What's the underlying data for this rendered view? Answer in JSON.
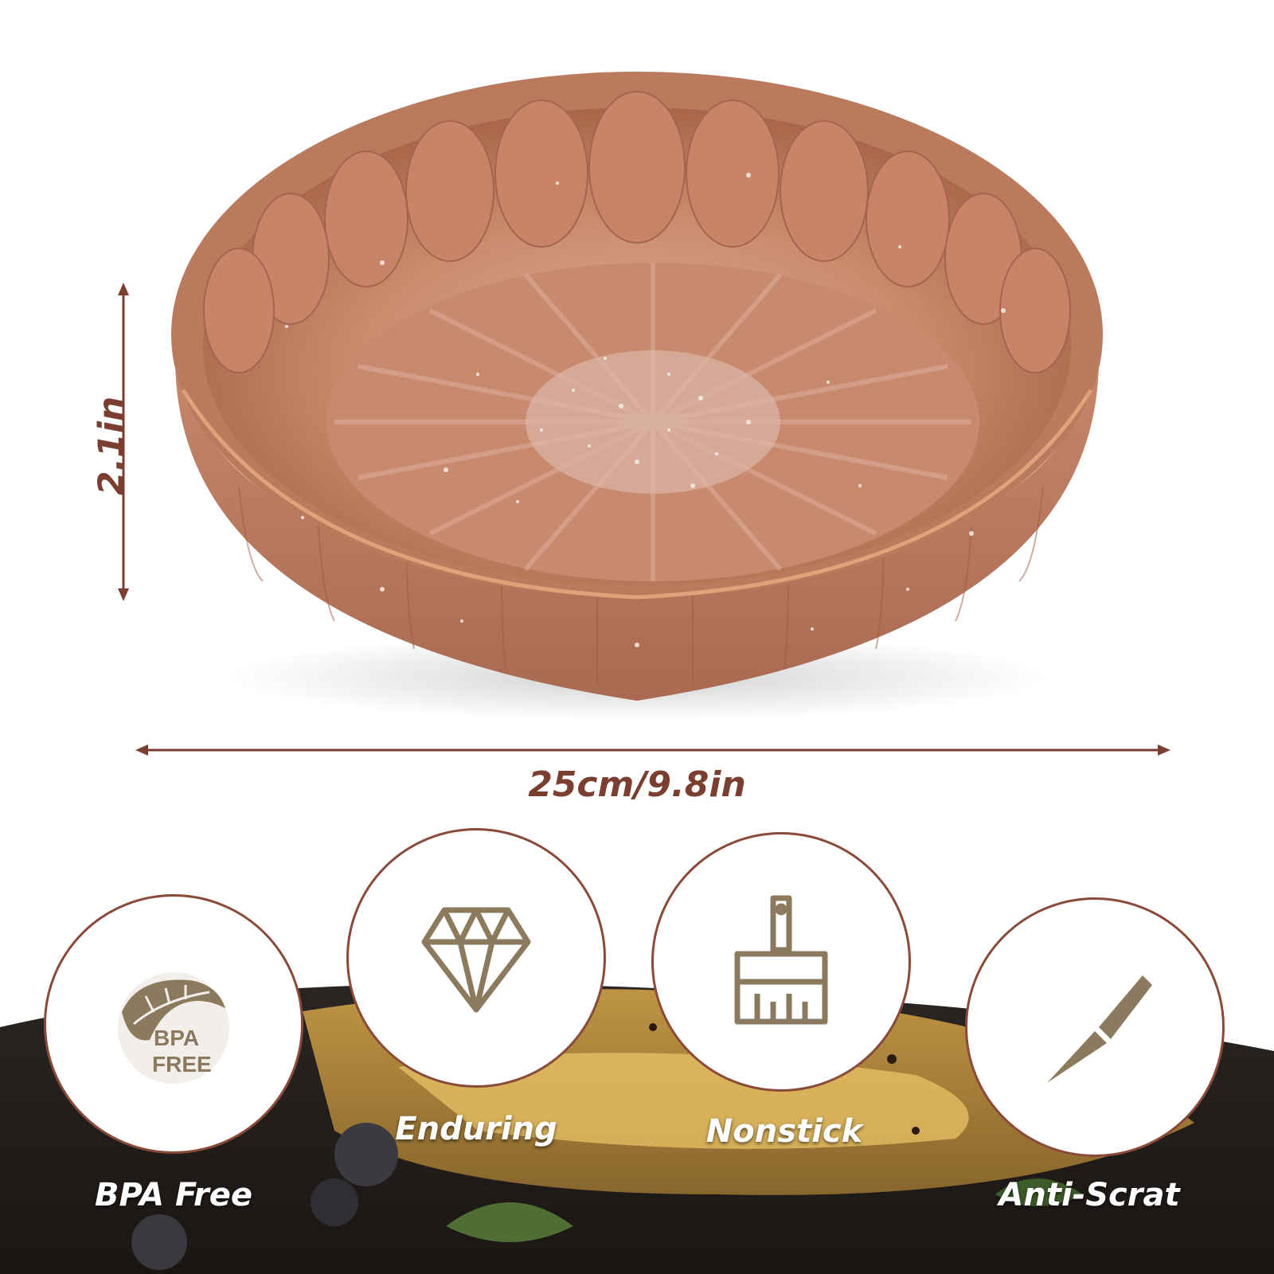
{
  "dimensions": {
    "height_label": "2.1in",
    "width_label": "25cm/9.8in",
    "annotation_color": "#7a3f30"
  },
  "product": {
    "pan_color": "#c8886a",
    "rim_color": "#b8775a",
    "speckle_color": "#f4ece6"
  },
  "features": [
    {
      "label": "BPA Free",
      "icon": "bpa-free-leaf-icon",
      "badge_line1": "BPA",
      "badge_line2": "FREE"
    },
    {
      "label": "Enduring",
      "icon": "diamond-icon"
    },
    {
      "label": "Nonstick",
      "icon": "brush-icon"
    },
    {
      "label": "Anti-Scrat",
      "icon": "knife-icon"
    }
  ],
  "colors": {
    "circle_border": "#8a4a3a",
    "icon_color": "#8c7a5f",
    "label_color": "#ffffff"
  }
}
